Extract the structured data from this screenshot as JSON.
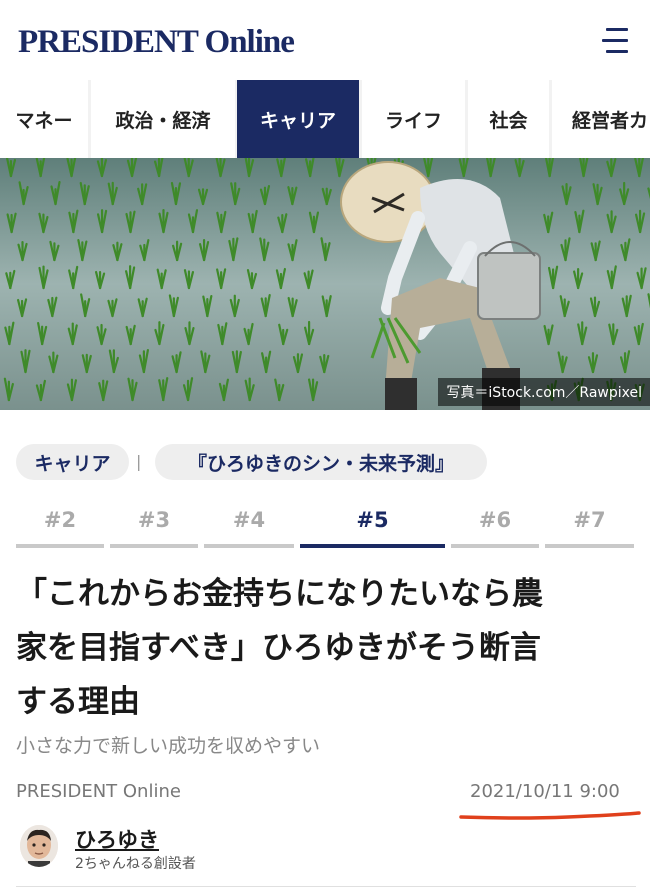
{
  "header": {
    "logo": "PRESIDENT Online",
    "menu_icon": "hamburger-menu-icon"
  },
  "nav": {
    "items": [
      {
        "label": "マネー"
      },
      {
        "label": "政治・経済"
      },
      {
        "label": "キャリア",
        "active": true
      },
      {
        "label": "ライフ"
      },
      {
        "label": "社会"
      },
      {
        "label": "経営者カ"
      }
    ]
  },
  "hero": {
    "credit": "写真＝iStock.com／Rawpixel"
  },
  "tags": {
    "category": "キャリア",
    "separator": "|",
    "series": "『ひろゆきのシン・未来予測』"
  },
  "series_tabs": [
    "#2",
    "#3",
    "#4",
    "#5",
    "#6",
    "#7"
  ],
  "series_active": "#5",
  "article": {
    "title_line1": "「これからお金持ちになりたいなら農",
    "title_line2": "家を目指すべき」ひろゆきがそう断言",
    "title_line3": "する理由",
    "subtitle": "小さな力で新しい成功を収めやすい",
    "source": "PRESIDENT Online",
    "date": "2021/10/11 9:00"
  },
  "author": {
    "name": "ひろゆき",
    "role": "2ちゃんねる創設者"
  },
  "colors": {
    "brand_navy": "#1b2a63",
    "highlight_red": "#e0401c"
  }
}
